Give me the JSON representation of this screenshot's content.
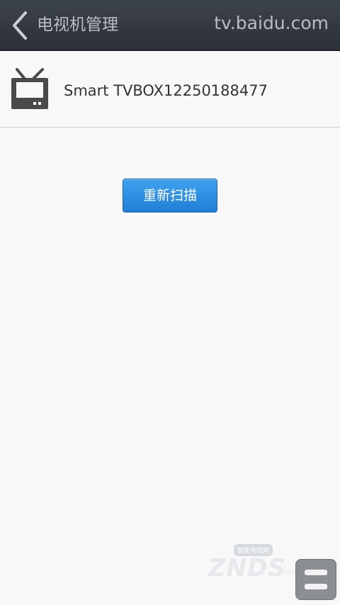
{
  "header": {
    "title": "电视机管理",
    "domain": "tv.baidu.com",
    "back_icon": "chevron-left-icon"
  },
  "device": {
    "name": "Smart TVBOX12250188477",
    "icon": "tv-icon"
  },
  "actions": {
    "rescan_label": "重新扫描"
  },
  "watermark": {
    "logo": "ZNDS",
    "domain": ".com",
    "tagline": "智能电视网"
  },
  "menu": {
    "icon": "menu-icon"
  },
  "colors": {
    "header_bg": "#31353d",
    "header_text": "#b9bec6",
    "button_blue": "#2b8ee2",
    "page_bg": "#f8f8f8"
  }
}
